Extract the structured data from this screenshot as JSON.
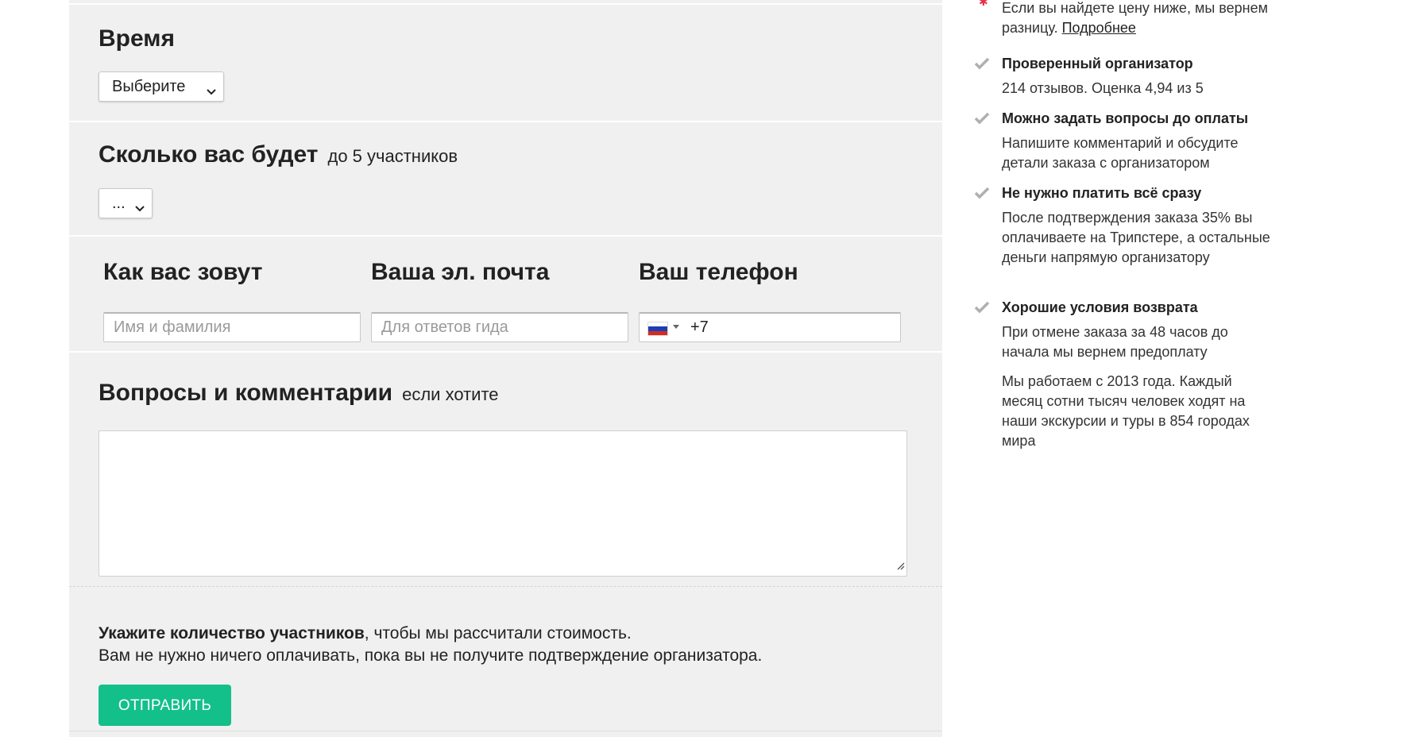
{
  "time": {
    "title": "Время",
    "select_value": "Выберите"
  },
  "participants": {
    "title": "Сколько вас будет",
    "hint": "до 5 участников",
    "select_value": "..."
  },
  "contacts": {
    "name_label": "Как вас зовут",
    "name_placeholder": "Имя и фамилия",
    "email_label": "Ваша эл. почта",
    "email_placeholder": "Для ответов гида",
    "phone_label": "Ваш телефон",
    "phone_code": "+7",
    "phone_country_icon": "russia-flag-icon"
  },
  "comments": {
    "title": "Вопросы и комментарии",
    "hint": "если хотите",
    "value": ""
  },
  "notice": {
    "bold": "Укажите количество участников",
    "rest": ", чтобы мы рассчитали стоимость.",
    "line2": "Вам не нужно ничего оплачивать, пока вы не получите подтверждение организатора."
  },
  "submit_label": "ОТПРАВИТЬ",
  "sidebar": {
    "price_guarantee_text": "Если вы найдете цену ниже, мы вернем разницу.",
    "price_guarantee_link": "Подробнее",
    "items": [
      {
        "title": "Проверенный организатор",
        "text": "214 отзывов. Оценка 4,94 из 5"
      },
      {
        "title": "Можно задать вопросы до оплаты",
        "text": "Напишите комментарий и обсудите детали заказа с организатором"
      },
      {
        "title": "Не нужно платить всё сразу",
        "text": "После подтверждения заказа 35% вы оплачиваете на Трипстере, а остальные деньги напрямую организатору"
      },
      {
        "title": "Хорошие условия возврата",
        "text": "При отмене заказа за 48 часов до начала мы вернем предоплату"
      }
    ],
    "about": "Мы работаем с 2013 года. Каждый месяц сотни тысяч человек ходят на наши экскурсии и туры в 854 городах мира"
  },
  "colors": {
    "accent": "#13c08a",
    "panel_bg": "#f0f0f0",
    "check": "#b0b0b0"
  }
}
